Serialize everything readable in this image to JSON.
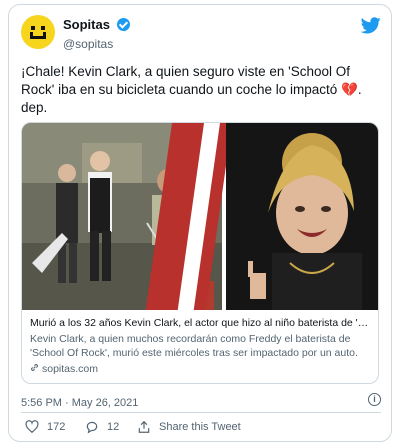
{
  "author": {
    "display_name": "Sopitas",
    "handle": "@sopitas",
    "verified": true
  },
  "tweet": {
    "text": "¡Chale! Kevin Clark, a quien seguro viste en 'School Of Rock' iba en su bicicleta cuando un coche lo impactó",
    "text_tail": ". dep."
  },
  "link_card": {
    "title": "Murió a los 32 años Kevin Clark, el actor que hizo al niño baterista de 'Sc...",
    "description": "Kevin Clark, a quien muchos recordarán como Freddy el baterista de 'School Of Rock', murió este miércoles tras ser impactado por un auto.",
    "domain": "sopitas.com"
  },
  "timestamp": "5:56 PM · May 26, 2021",
  "actions": {
    "likes": "172",
    "replies": "12",
    "share_label": "Share this Tweet"
  },
  "colors": {
    "accent": "#1d9bf0",
    "avatar_bg": "#f7d51d",
    "secondary_text": "#536471"
  },
  "icons": [
    "twitter-bird-icon",
    "verified-badge-icon",
    "broken-heart-icon",
    "link-icon",
    "info-icon",
    "heart-icon",
    "reply-icon",
    "share-icon"
  ]
}
